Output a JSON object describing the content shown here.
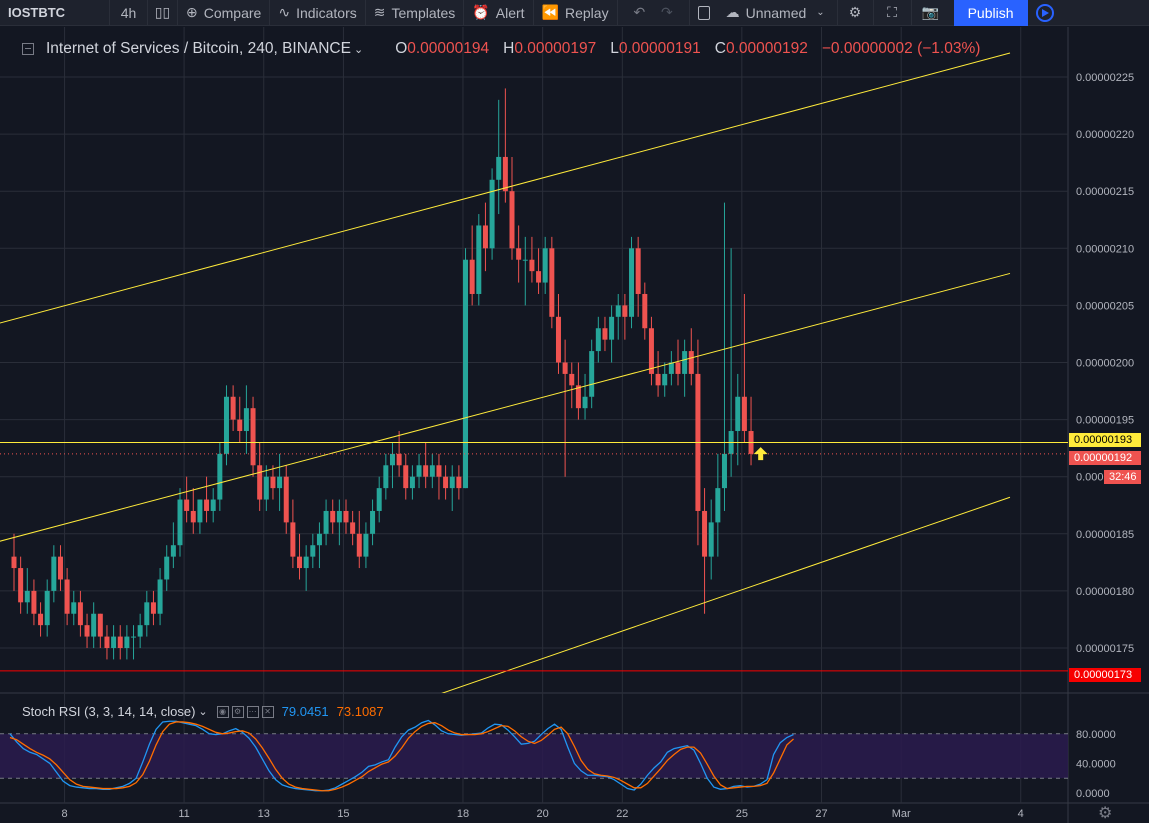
{
  "toolbar": {
    "symbol": "IOSTBTC",
    "interval": "4h",
    "compare": "Compare",
    "indicators": "Indicators",
    "templates": "Templates",
    "alert": "Alert",
    "replay": "Replay",
    "layout_name": "Unnamed",
    "publish": "Publish"
  },
  "legend": {
    "title": "Internet of Services / Bitcoin, 240, BINANCE",
    "o_key": "O",
    "o_val": "0.00000194",
    "h_key": "H",
    "h_val": "0.00000197",
    "l_key": "L",
    "l_val": "0.00000191",
    "c_key": "C",
    "c_val": "0.00000192",
    "change": "−0.00000002 (−1.03%)"
  },
  "rsi_legend": {
    "title": "Stoch RSI (3, 3, 14, 14, close)",
    "k": "79.0451",
    "d": "73.1087"
  },
  "price_labels": {
    "hline": "0.00000193",
    "last": "0.00000192",
    "timer": "32:46",
    "support": "0.00000173"
  },
  "colors": {
    "background": "#131722",
    "up": "#26a69a",
    "down": "#ef5350",
    "channel": "#ffeb3b",
    "support": "#f70000",
    "rsi_k": "#2196f3",
    "rsi_d": "#ff6d00",
    "rsi_band": "#2a1b4d"
  },
  "chart_data": [
    {
      "type": "candlestick",
      "symbol": "IOSTBTC",
      "exchange": "BINANCE",
      "interval": "240",
      "ylim": [
        1.715e-07,
        2.265e-07
      ],
      "y_ticks": [
        "0.00000225",
        "0.00000220",
        "0.00000215",
        "0.00000210",
        "0.00000205",
        "0.00000200",
        "0.00000195",
        "0.00000190",
        "0.00000185",
        "0.00000180",
        "0.00000175"
      ],
      "x_ticks": [
        {
          "label": "8",
          "index": 4
        },
        {
          "label": "11",
          "index": 22
        },
        {
          "label": "13",
          "index": 34
        },
        {
          "label": "15",
          "index": 46
        },
        {
          "label": "18",
          "index": 64
        },
        {
          "label": "20",
          "index": 76
        },
        {
          "label": "22",
          "index": 88
        },
        {
          "label": "25",
          "index": 106
        },
        {
          "label": "27",
          "index": 118
        },
        {
          "label": "Mar",
          "index": 130
        },
        {
          "label": "4",
          "index": 148
        }
      ],
      "candles": [
        [
          1.83,
          1.85,
          1.8,
          1.82
        ],
        [
          1.82,
          1.83,
          1.78,
          1.79
        ],
        [
          1.79,
          1.82,
          1.78,
          1.8
        ],
        [
          1.8,
          1.81,
          1.77,
          1.78
        ],
        [
          1.78,
          1.79,
          1.76,
          1.77
        ],
        [
          1.77,
          1.81,
          1.76,
          1.8
        ],
        [
          1.8,
          1.84,
          1.79,
          1.83
        ],
        [
          1.83,
          1.84,
          1.8,
          1.81
        ],
        [
          1.81,
          1.82,
          1.77,
          1.78
        ],
        [
          1.78,
          1.8,
          1.77,
          1.79
        ],
        [
          1.79,
          1.8,
          1.76,
          1.77
        ],
        [
          1.77,
          1.78,
          1.75,
          1.76
        ],
        [
          1.76,
          1.79,
          1.75,
          1.78
        ],
        [
          1.78,
          1.78,
          1.75,
          1.76
        ],
        [
          1.76,
          1.77,
          1.74,
          1.75
        ],
        [
          1.75,
          1.77,
          1.74,
          1.76
        ],
        [
          1.76,
          1.77,
          1.74,
          1.75
        ],
        [
          1.75,
          1.77,
          1.74,
          1.76
        ],
        [
          1.76,
          1.77,
          1.74,
          1.76
        ],
        [
          1.76,
          1.78,
          1.75,
          1.77
        ],
        [
          1.77,
          1.8,
          1.76,
          1.79
        ],
        [
          1.79,
          1.8,
          1.77,
          1.78
        ],
        [
          1.78,
          1.82,
          1.77,
          1.81
        ],
        [
          1.81,
          1.84,
          1.8,
          1.83
        ],
        [
          1.83,
          1.86,
          1.82,
          1.84
        ],
        [
          1.84,
          1.89,
          1.83,
          1.88
        ],
        [
          1.88,
          1.9,
          1.86,
          1.87
        ],
        [
          1.87,
          1.89,
          1.85,
          1.86
        ],
        [
          1.86,
          1.88,
          1.85,
          1.88
        ],
        [
          1.88,
          1.9,
          1.86,
          1.87
        ],
        [
          1.87,
          1.89,
          1.86,
          1.88
        ],
        [
          1.88,
          1.93,
          1.87,
          1.92
        ],
        [
          1.92,
          1.98,
          1.91,
          1.97
        ],
        [
          1.97,
          1.98,
          1.94,
          1.95
        ],
        [
          1.95,
          1.97,
          1.93,
          1.94
        ],
        [
          1.94,
          1.98,
          1.92,
          1.96
        ],
        [
          1.96,
          1.97,
          1.9,
          1.91
        ],
        [
          1.91,
          1.93,
          1.87,
          1.88
        ],
        [
          1.88,
          1.91,
          1.87,
          1.9
        ],
        [
          1.9,
          1.91,
          1.88,
          1.89
        ],
        [
          1.89,
          1.92,
          1.87,
          1.9
        ],
        [
          1.9,
          1.91,
          1.85,
          1.86
        ],
        [
          1.86,
          1.88,
          1.82,
          1.83
        ],
        [
          1.83,
          1.85,
          1.81,
          1.82
        ],
        [
          1.82,
          1.84,
          1.8,
          1.83
        ],
        [
          1.83,
          1.85,
          1.82,
          1.84
        ],
        [
          1.84,
          1.86,
          1.82,
          1.85
        ],
        [
          1.85,
          1.88,
          1.84,
          1.87
        ],
        [
          1.87,
          1.88,
          1.85,
          1.86
        ],
        [
          1.86,
          1.88,
          1.84,
          1.87
        ],
        [
          1.87,
          1.88,
          1.85,
          1.86
        ],
        [
          1.86,
          1.87,
          1.84,
          1.85
        ],
        [
          1.85,
          1.87,
          1.82,
          1.83
        ],
        [
          1.83,
          1.86,
          1.82,
          1.85
        ],
        [
          1.85,
          1.88,
          1.84,
          1.87
        ],
        [
          1.87,
          1.9,
          1.86,
          1.89
        ],
        [
          1.89,
          1.92,
          1.88,
          1.91
        ],
        [
          1.91,
          1.93,
          1.89,
          1.92
        ],
        [
          1.92,
          1.94,
          1.9,
          1.91
        ],
        [
          1.91,
          1.92,
          1.88,
          1.89
        ],
        [
          1.89,
          1.91,
          1.88,
          1.9
        ],
        [
          1.9,
          1.92,
          1.89,
          1.91
        ],
        [
          1.91,
          1.93,
          1.89,
          1.9
        ],
        [
          1.9,
          1.92,
          1.89,
          1.91
        ],
        [
          1.91,
          1.92,
          1.88,
          1.9
        ],
        [
          1.9,
          1.91,
          1.88,
          1.89
        ],
        [
          1.89,
          1.91,
          1.87,
          1.9
        ],
        [
          1.9,
          1.91,
          1.88,
          1.89
        ],
        [
          1.89,
          2.1,
          1.89,
          2.09
        ],
        [
          2.09,
          2.12,
          2.05,
          2.06
        ],
        [
          2.06,
          2.13,
          2.05,
          2.12
        ],
        [
          2.12,
          2.14,
          2.08,
          2.1
        ],
        [
          2.1,
          2.17,
          2.09,
          2.16
        ],
        [
          2.16,
          2.23,
          2.13,
          2.18
        ],
        [
          2.18,
          2.24,
          2.14,
          2.15
        ],
        [
          2.15,
          2.18,
          2.09,
          2.1
        ],
        [
          2.1,
          2.12,
          2.07,
          2.09
        ],
        [
          2.09,
          2.11,
          2.05,
          2.09
        ],
        [
          2.09,
          2.11,
          2.07,
          2.08
        ],
        [
          2.08,
          2.1,
          2.06,
          2.07
        ],
        [
          2.07,
          2.11,
          2.06,
          2.1
        ],
        [
          2.1,
          2.11,
          2.03,
          2.04
        ],
        [
          2.04,
          2.06,
          1.99,
          2.0
        ],
        [
          2.0,
          2.02,
          1.9,
          1.99
        ],
        [
          1.99,
          2.0,
          1.96,
          1.98
        ],
        [
          1.98,
          2.0,
          1.95,
          1.96
        ],
        [
          1.96,
          1.99,
          1.95,
          1.97
        ],
        [
          1.97,
          2.02,
          1.96,
          2.01
        ],
        [
          2.01,
          2.04,
          2.0,
          2.03
        ],
        [
          2.03,
          2.04,
          2.01,
          2.02
        ],
        [
          2.02,
          2.05,
          2.0,
          2.04
        ],
        [
          2.04,
          2.06,
          2.02,
          2.05
        ],
        [
          2.05,
          2.06,
          2.02,
          2.04
        ],
        [
          2.04,
          2.11,
          2.03,
          2.1
        ],
        [
          2.1,
          2.11,
          2.04,
          2.06
        ],
        [
          2.06,
          2.07,
          2.02,
          2.03
        ],
        [
          2.03,
          2.04,
          1.98,
          1.99
        ],
        [
          1.99,
          2.01,
          1.97,
          1.98
        ],
        [
          1.98,
          2.0,
          1.97,
          1.99
        ],
        [
          1.99,
          2.01,
          1.98,
          2.0
        ],
        [
          2.0,
          2.02,
          1.98,
          1.99
        ],
        [
          1.99,
          2.02,
          1.97,
          2.01
        ],
        [
          2.01,
          2.03,
          1.98,
          1.99
        ],
        [
          1.99,
          2.02,
          1.84,
          1.87
        ],
        [
          1.87,
          1.89,
          1.78,
          1.83
        ],
        [
          1.83,
          1.88,
          1.81,
          1.86
        ],
        [
          1.86,
          1.92,
          1.83,
          1.89
        ],
        [
          1.89,
          2.14,
          1.87,
          1.92
        ],
        [
          1.92,
          2.1,
          1.9,
          1.94
        ],
        [
          1.94,
          1.99,
          1.91,
          1.97
        ],
        [
          1.97,
          2.06,
          1.93,
          1.94
        ],
        [
          1.94,
          1.97,
          1.91,
          1.92
        ]
      ],
      "horizontal_lines": [
        {
          "price": 1.93e-06,
          "color": "#ffeb3b",
          "style": "solid"
        },
        {
          "price": 1.92e-06,
          "color": "#ef5350",
          "style": "dotted"
        },
        {
          "price": 1.73e-06,
          "color": "#f70000",
          "style": "solid"
        }
      ],
      "channel_lines": [
        {
          "x1": -7,
          "y1": 2.027,
          "x2": 150,
          "y2": 2.271
        },
        {
          "x1": -7,
          "y1": 1.836,
          "x2": 150,
          "y2": 2.078
        },
        {
          "x1": -7,
          "y1": 1.567,
          "x2": 150,
          "y2": 1.882
        }
      ],
      "arrow_marker": {
        "index": 112,
        "price": 1.925e-06,
        "color": "#ffeb3b"
      }
    },
    {
      "type": "line",
      "title": "Stoch RSI (3, 3, 14, 14, close)",
      "ylim": [
        0,
        100
      ],
      "y_ticks": [
        "80.0000",
        "40.0000",
        "0.0000"
      ],
      "band": [
        20,
        80
      ],
      "series": [
        {
          "name": "K",
          "values": [
            80,
            69,
            60,
            55,
            52,
            46,
            40,
            28,
            16,
            10,
            8,
            7,
            6,
            6,
            5,
            5,
            7,
            9,
            13,
            20,
            42,
            66,
            86,
            96,
            97,
            97,
            95,
            93,
            91,
            86,
            80,
            79,
            80,
            84,
            87,
            82,
            74,
            62,
            46,
            30,
            18,
            11,
            8,
            6,
            5,
            4,
            3,
            3,
            4,
            7,
            12,
            17,
            22,
            28,
            36,
            38,
            42,
            45,
            62,
            76,
            85,
            89,
            95,
            98,
            92,
            84,
            80,
            79,
            78,
            79,
            80,
            81,
            88,
            93,
            92,
            85,
            76,
            66,
            67,
            70,
            79,
            87,
            93,
            86,
            62,
            40,
            30,
            24,
            24,
            23,
            22,
            18,
            12,
            6,
            4,
            12,
            24,
            34,
            42,
            55,
            60,
            62,
            64,
            58,
            40,
            20,
            8,
            5,
            6,
            9,
            10,
            8,
            9,
            12,
            18,
            52,
            68,
            75,
            79
          ]
        },
        {
          "name": "D",
          "values": [
            75,
            72,
            66,
            60,
            55,
            51,
            46,
            38,
            28,
            18,
            12,
            9,
            8,
            7,
            6,
            6,
            6,
            7,
            9,
            14,
            25,
            43,
            65,
            83,
            93,
            96,
            96,
            95,
            93,
            90,
            86,
            82,
            80,
            81,
            83,
            84,
            81,
            73,
            61,
            47,
            32,
            20,
            12,
            8,
            6,
            5,
            4,
            3,
            3,
            5,
            8,
            12,
            17,
            22,
            29,
            34,
            39,
            42,
            50,
            61,
            74,
            83,
            90,
            94,
            95,
            91,
            85,
            81,
            79,
            79,
            79,
            80,
            83,
            87,
            91,
            90,
            84,
            76,
            70,
            67,
            71,
            78,
            86,
            89,
            80,
            63,
            44,
            32,
            26,
            24,
            23,
            21,
            17,
            12,
            7,
            7,
            13,
            23,
            33,
            44,
            52,
            59,
            62,
            62,
            54,
            39,
            23,
            11,
            6,
            7,
            8,
            9,
            9,
            10,
            13,
            27,
            46,
            65,
            73
          ]
        }
      ]
    }
  ]
}
